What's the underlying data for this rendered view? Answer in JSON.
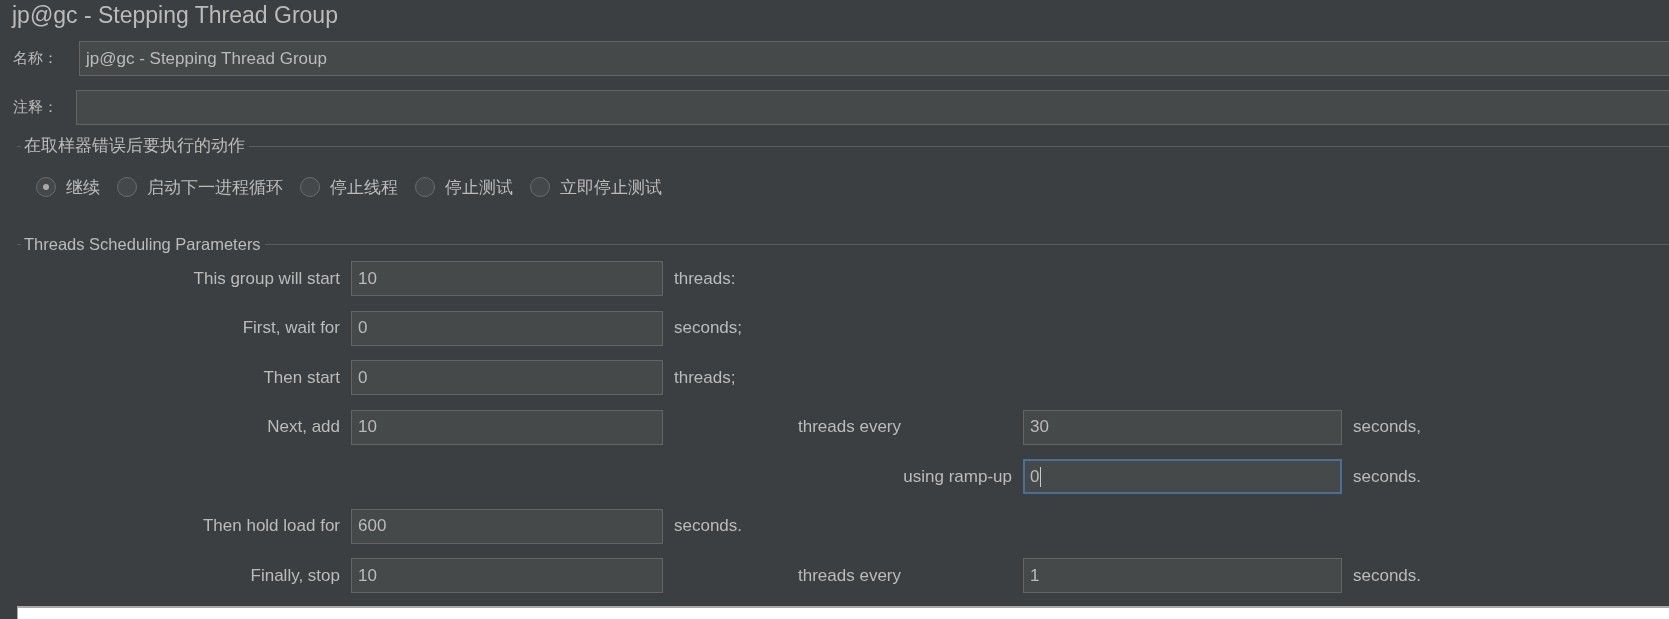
{
  "title": "jp@gc - Stepping Thread Group",
  "name_field": {
    "label": "名称：",
    "value": "jp@gc - Stepping Thread Group"
  },
  "comment_field": {
    "label": "注释："
  },
  "sampler_error_action": {
    "title": "在取样器错误后要执行的动作",
    "options": [
      {
        "label": "继续",
        "selected": true
      },
      {
        "label": "启动下一进程循环",
        "selected": false
      },
      {
        "label": "停止线程",
        "selected": false
      },
      {
        "label": "停止测试",
        "selected": false
      },
      {
        "label": "立即停止测试",
        "selected": false
      }
    ]
  },
  "threads_scheduling": {
    "title": "Threads Scheduling Parameters",
    "rows": [
      {
        "label": "This group will start",
        "value": "10",
        "suffix": "threads:"
      },
      {
        "label": "First, wait for",
        "value": "0",
        "suffix": "seconds;"
      },
      {
        "label": "Then start",
        "value": "0",
        "suffix": "threads;"
      },
      {
        "label": "Next, add",
        "value": "10",
        "extra": {
          "label": "threads every",
          "value": "30",
          "suffix": "seconds,",
          "focused": false
        }
      },
      {
        "extra": {
          "label": "using ramp-up",
          "value": "0",
          "suffix": "seconds.",
          "focused": true
        }
      },
      {
        "label": "Then hold load for",
        "value": "600",
        "suffix": "seconds."
      },
      {
        "label": "Finally, stop",
        "value": "10",
        "extra": {
          "label": "threads every",
          "value": "1",
          "suffix": "seconds.",
          "focused": false
        }
      }
    ]
  }
}
